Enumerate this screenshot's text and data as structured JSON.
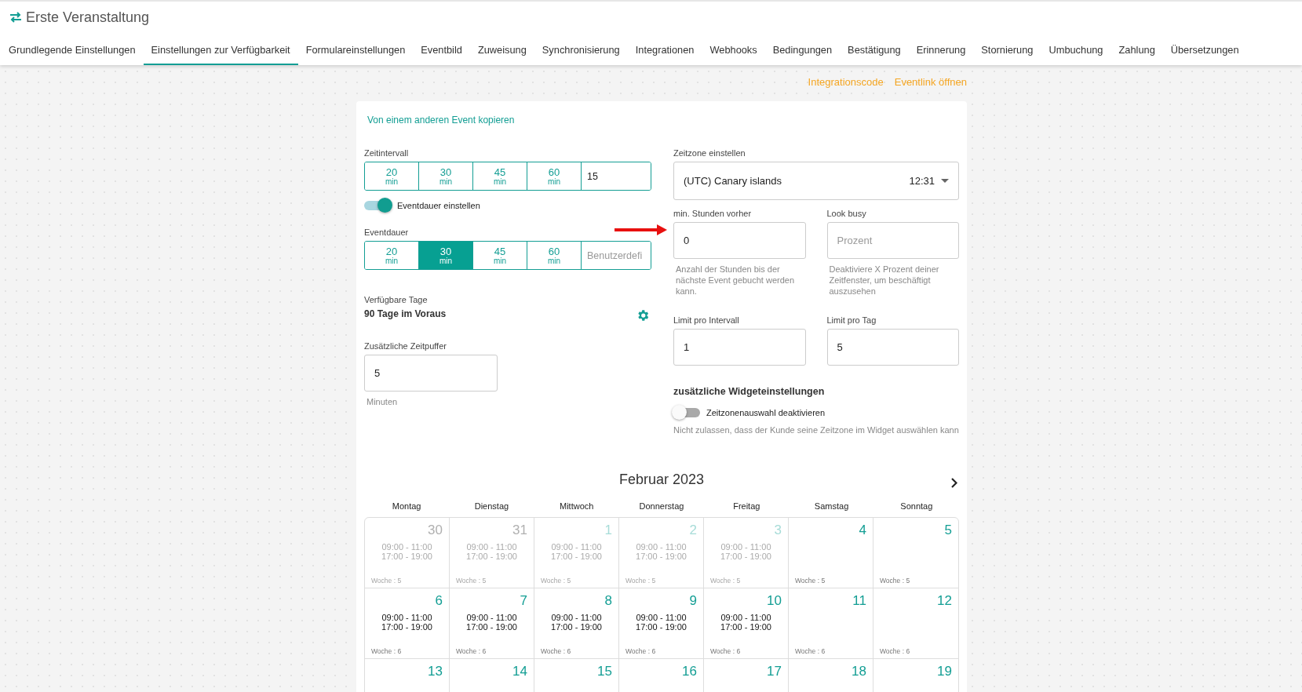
{
  "header": {
    "title": "Erste Veranstaltung"
  },
  "tabs": [
    {
      "label": "Grundlegende Einstellungen",
      "selected": false
    },
    {
      "label": "Einstellungen zur Verfügbarkeit",
      "selected": true
    },
    {
      "label": "Formulareinstellungen",
      "selected": false
    },
    {
      "label": "Eventbild",
      "selected": false
    },
    {
      "label": "Zuweisung",
      "selected": false
    },
    {
      "label": "Synchronisierung",
      "selected": false
    },
    {
      "label": "Integrationen",
      "selected": false
    },
    {
      "label": "Webhooks",
      "selected": false
    },
    {
      "label": "Bedingungen",
      "selected": false
    },
    {
      "label": "Bestätigung",
      "selected": false
    },
    {
      "label": "Erinnerung",
      "selected": false
    },
    {
      "label": "Stornierung",
      "selected": false
    },
    {
      "label": "Umbuchung",
      "selected": false
    },
    {
      "label": "Zahlung",
      "selected": false
    },
    {
      "label": "Übersetzungen",
      "selected": false
    }
  ],
  "links": [
    "Integrationscode",
    "Eventlink öffnen"
  ],
  "copy_link": "Von einem anderen Event kopieren",
  "time_interval": {
    "label": "Zeitintervall",
    "options": [
      {
        "value": "20",
        "unit": "min",
        "selected": false
      },
      {
        "value": "30",
        "unit": "min",
        "selected": false
      },
      {
        "value": "45",
        "unit": "min",
        "selected": false
      },
      {
        "value": "60",
        "unit": "min",
        "selected": false
      }
    ],
    "custom_value": "15"
  },
  "duration_toggle": {
    "label": "Eventdauer einstellen",
    "on": true
  },
  "duration": {
    "label": "Eventdauer",
    "options": [
      {
        "value": "20",
        "unit": "min",
        "selected": false
      },
      {
        "value": "30",
        "unit": "min",
        "selected": true
      },
      {
        "value": "45",
        "unit": "min",
        "selected": false
      },
      {
        "value": "60",
        "unit": "min",
        "selected": false
      }
    ],
    "custom_placeholder": "Benutzerdefi"
  },
  "available_days": {
    "label": "Verfügbare Tage",
    "value": "90 Tage im Voraus"
  },
  "buffer": {
    "label": "Zusätzliche Zeitpuffer",
    "value": "5",
    "hint": "Minuten"
  },
  "timezone": {
    "label": "Zeitzone einstellen",
    "value": "(UTC) Canary islands",
    "time": "12:31"
  },
  "fields": [
    {
      "label": "min. Stunden vorher",
      "value": "0",
      "hint": "Anzahl der Stunden bis der nächste Event gebucht werden kann."
    },
    {
      "label": "Look busy",
      "placeholder": "Prozent",
      "hint": "Deaktiviere X Prozent deiner Zeitfenster, um beschäftigt auszusehen"
    },
    {
      "label": "Limit pro Intervall",
      "value": "1"
    },
    {
      "label": "Limit pro Tag",
      "value": "5"
    }
  ],
  "widget_settings": {
    "heading": "zusätzliche Widgeteinstellungen",
    "toggle": {
      "label": "Zeitzonenauswahl deaktivieren",
      "on": false
    },
    "hint": "Nicht zulassen, dass der Kunde seine Zeitzone im Widget auswählen kann"
  },
  "calendar": {
    "title": "Februar 2023",
    "weekdays": [
      "Montag",
      "Dienstag",
      "Mittwoch",
      "Donnerstag",
      "Freitag",
      "Samstag",
      "Sonntag"
    ],
    "weeks": [
      [
        {
          "day": "30",
          "other_month": true,
          "past": true,
          "times": [
            "09:00 - 11:00",
            "17:00 - 19:00"
          ],
          "week": "Woche : 5"
        },
        {
          "day": "31",
          "other_month": true,
          "past": true,
          "times": [
            "09:00 - 11:00",
            "17:00 - 19:00"
          ],
          "week": "Woche : 5"
        },
        {
          "day": "1",
          "other_month": false,
          "past": true,
          "times": [
            "09:00 - 11:00",
            "17:00 - 19:00"
          ],
          "week": "Woche : 5"
        },
        {
          "day": "2",
          "other_month": false,
          "past": true,
          "times": [
            "09:00 - 11:00",
            "17:00 - 19:00"
          ],
          "week": "Woche : 5"
        },
        {
          "day": "3",
          "other_month": false,
          "past": true,
          "times": [
            "09:00 - 11:00",
            "17:00 - 19:00"
          ],
          "week": "Woche : 5"
        },
        {
          "day": "4",
          "other_month": false,
          "past": false,
          "week": "Woche : 5"
        },
        {
          "day": "5",
          "other_month": false,
          "past": false,
          "week": "Woche : 5"
        }
      ],
      [
        {
          "day": "6",
          "other_month": false,
          "past": false,
          "times": [
            "09:00 - 11:00",
            "17:00 - 19:00"
          ],
          "week": "Woche : 6"
        },
        {
          "day": "7",
          "other_month": false,
          "past": false,
          "times": [
            "09:00 - 11:00",
            "17:00 - 19:00"
          ],
          "week": "Woche : 6"
        },
        {
          "day": "8",
          "other_month": false,
          "past": false,
          "times": [
            "09:00 - 11:00",
            "17:00 - 19:00"
          ],
          "week": "Woche : 6"
        },
        {
          "day": "9",
          "other_month": false,
          "past": false,
          "times": [
            "09:00 - 11:00",
            "17:00 - 19:00"
          ],
          "week": "Woche : 6"
        },
        {
          "day": "10",
          "other_month": false,
          "past": false,
          "times": [
            "09:00 - 11:00",
            "17:00 - 19:00"
          ],
          "week": "Woche : 6"
        },
        {
          "day": "11",
          "other_month": false,
          "past": false,
          "week": "Woche : 6"
        },
        {
          "day": "12",
          "other_month": false,
          "past": false,
          "week": "Woche : 6"
        }
      ],
      [
        {
          "day": "13",
          "other_month": false,
          "past": false
        },
        {
          "day": "14",
          "other_month": false,
          "past": false
        },
        {
          "day": "15",
          "other_month": false,
          "past": false
        },
        {
          "day": "16",
          "other_month": false,
          "past": false
        },
        {
          "day": "17",
          "other_month": false,
          "past": false
        },
        {
          "day": "18",
          "other_month": false,
          "past": false
        },
        {
          "day": "19",
          "other_month": false,
          "past": false
        }
      ]
    ]
  }
}
